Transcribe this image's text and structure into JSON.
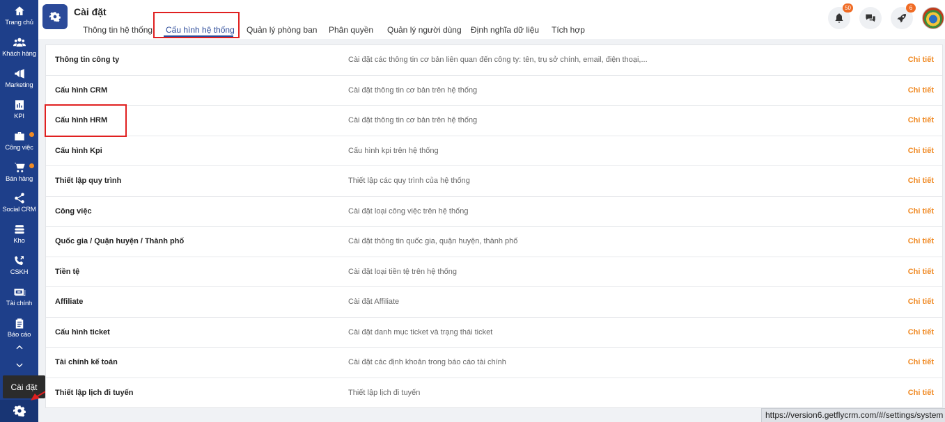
{
  "sidebar": {
    "items": [
      {
        "label": "Trang chủ",
        "icon": "home-icon"
      },
      {
        "label": "Khách hàng",
        "icon": "users-icon"
      },
      {
        "label": "Marketing",
        "icon": "megaphone-icon"
      },
      {
        "label": "KPI",
        "icon": "bar-chart-icon"
      },
      {
        "label": "Công việc",
        "icon": "briefcase-icon"
      },
      {
        "label": "Bán hàng",
        "icon": "cart-icon"
      },
      {
        "label": "Social CRM",
        "icon": "share-icon"
      },
      {
        "label": "Kho",
        "icon": "warehouse-icon"
      },
      {
        "label": "CSKH",
        "icon": "phone-icon"
      },
      {
        "label": "Tài chính",
        "icon": "money-icon"
      },
      {
        "label": "Báo cáo",
        "icon": "clipboard-icon"
      }
    ],
    "tooltip": "Cài đặt",
    "settings_icon": "gear-icon"
  },
  "header": {
    "title": "Cài đặt",
    "tabs": [
      {
        "label": "Thông tin hệ thống"
      },
      {
        "label": "Cấu hình hệ thống"
      },
      {
        "label": "Quản lý phòng ban"
      },
      {
        "label": "Phân quyền"
      },
      {
        "label": "Quản lý người dùng"
      },
      {
        "label": "Định nghĩa dữ liệu"
      },
      {
        "label": "Tích hợp"
      }
    ],
    "active_tab": "Cấu hình hệ thống",
    "notifications_count": "50",
    "rocket_count": "6"
  },
  "settings_rows": [
    {
      "name": "Thông tin công ty",
      "desc": "Cài đặt các thông tin cơ bản liên quan đến công ty: tên, trụ sở chính, email, điện thoại,...",
      "link": "Chi tiết"
    },
    {
      "name": "Cấu hình CRM",
      "desc": "Cài đặt thông tin cơ bản trên hệ thống",
      "link": "Chi tiết"
    },
    {
      "name": "Cấu hình HRM",
      "desc": "Cài đặt thông tin cơ bản trên hệ thống",
      "link": "Chi tiết"
    },
    {
      "name": "Cấu hình Kpi",
      "desc": "Cấu hình kpi trên hệ thống",
      "link": "Chi tiết"
    },
    {
      "name": "Thiết lập quy trình",
      "desc": "Thiết lập các quy trình của hệ thống",
      "link": "Chi tiết"
    },
    {
      "name": "Công việc",
      "desc": "Cài đặt loại công việc trên hệ thống",
      "link": "Chi tiết"
    },
    {
      "name": "Quốc gia / Quận huyện / Thành phố",
      "desc": "Cài đặt thông tin quốc gia, quận huyện, thành phố",
      "link": "Chi tiết"
    },
    {
      "name": "Tiền tệ",
      "desc": "Cài đặt loại tiền tệ trên hệ thống",
      "link": "Chi tiết"
    },
    {
      "name": "Affiliate",
      "desc": "Cài đặt Affiliate",
      "link": "Chi tiết"
    },
    {
      "name": "Cấu hình ticket",
      "desc": "Cài đặt danh mục ticket và trạng thái ticket",
      "link": "Chi tiết"
    },
    {
      "name": "Tài chính kế toán",
      "desc": "Cài đặt các định khoản trong báo cáo tài chính",
      "link": "Chi tiết"
    },
    {
      "name": "Thiết lập lịch đi tuyến",
      "desc": "Thiết lập lịch đi tuyến",
      "link": "Chi tiết"
    }
  ],
  "status_url": "https://version6.getflycrm.com/#/settings/system",
  "colors": {
    "sidebar": "#1e3f8a",
    "accent": "#2b4a99",
    "link": "#f08a24",
    "highlight": "#e02020"
  }
}
